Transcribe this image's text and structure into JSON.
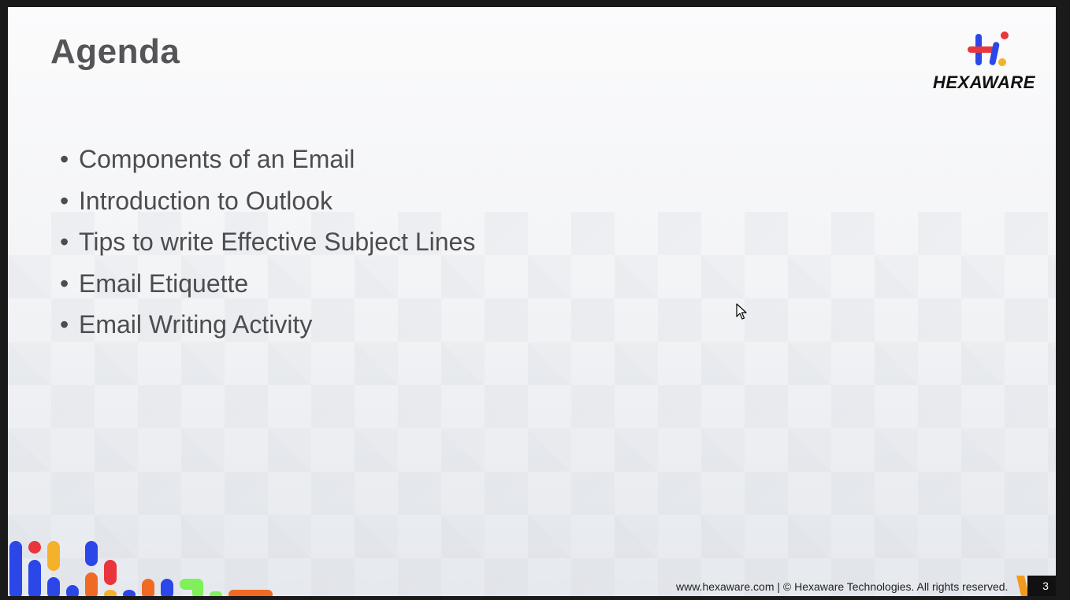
{
  "slide": {
    "title": "Agenda",
    "bullets": [
      "Components of an Email",
      "Introduction to Outlook",
      "Tips to write Effective Subject Lines",
      "Email Etiquette",
      "Email Writing Activity"
    ],
    "bullet_char": "•"
  },
  "logo": {
    "wordmark": "HEXAWARE",
    "glyph": "Hi",
    "colors": {
      "blue": "#2b47e8",
      "red": "#e8363c",
      "yellow": "#f6b12b"
    }
  },
  "footer": {
    "text": "www.hexaware.com  | © Hexaware Technologies. All rights reserved.",
    "page_number": "3",
    "tab_color": "#f29a1f",
    "page_bg": "#111111"
  },
  "colors": {
    "title": "#555557",
    "bullet_text": "#4d4d50",
    "deco_blue": "#2b47e8",
    "deco_red": "#e8363c",
    "deco_yellow": "#f6b12b",
    "deco_orange": "#f06a24",
    "deco_green": "#7ff05a"
  }
}
